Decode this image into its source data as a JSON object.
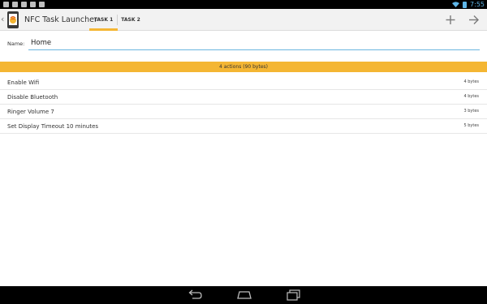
{
  "status_bar": {
    "time": "7:55",
    "notification_icons": [
      "play-icon",
      "play-icon",
      "play-icon",
      "play-icon",
      "keyboard-icon"
    ]
  },
  "action_bar": {
    "app_title": "NFC Task Launcher",
    "tabs": [
      {
        "label": "TASK 1",
        "selected": true
      },
      {
        "label": "TASK 2",
        "selected": false
      }
    ],
    "actions": [
      "add-icon",
      "arrow-right-icon"
    ]
  },
  "form": {
    "name_label": "Name:",
    "name_value": "Home"
  },
  "summary": "4 actions (90 bytes)",
  "actions": [
    {
      "name": "Enable Wifi",
      "size": "4 bytes"
    },
    {
      "name": "Disable Bluetooth",
      "size": "4 bytes"
    },
    {
      "name": "Ringer Volume 7",
      "size": "3 bytes"
    },
    {
      "name": "Set Display Timeout 10 minutes",
      "size": "5 bytes"
    }
  ],
  "colors": {
    "accent": "#f4b633",
    "input_underline": "#6cb6df",
    "status_blue": "#5fb6e8"
  }
}
